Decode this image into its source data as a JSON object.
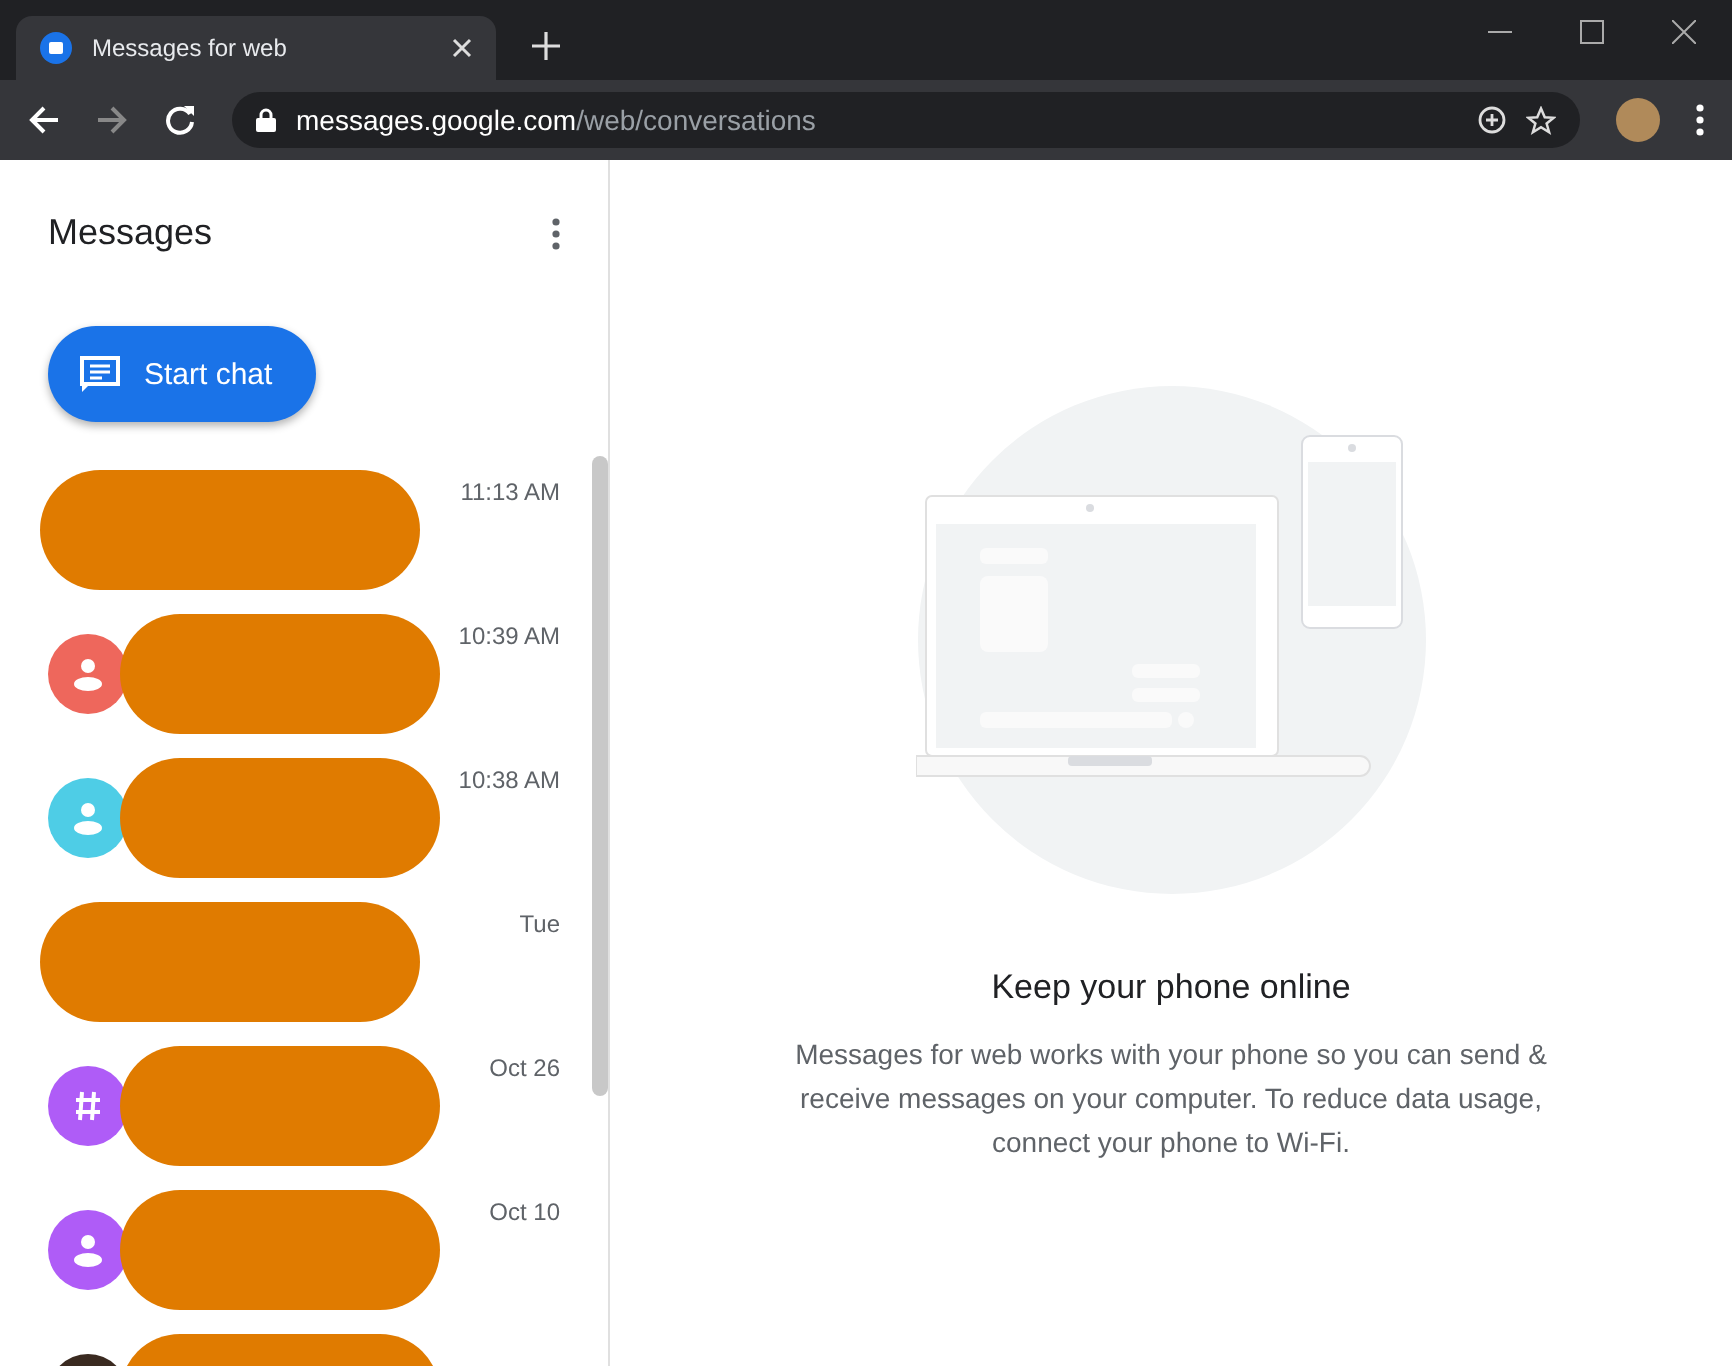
{
  "browser": {
    "tab_title": "Messages for web",
    "url_host": "messages.google.com",
    "url_path": "/web/conversations"
  },
  "sidebar": {
    "title": "Messages",
    "start_chat": "Start chat",
    "conversations": [
      {
        "kind": "plain",
        "time": "11:13 AM"
      },
      {
        "kind": "person",
        "color": "#ee675c",
        "time": "10:39 AM"
      },
      {
        "kind": "person",
        "color": "#4ecde6",
        "time": "10:38 AM"
      },
      {
        "kind": "plain",
        "time": "Tue"
      },
      {
        "kind": "group",
        "color": "#af5cf7",
        "time": "Oct 26"
      },
      {
        "kind": "person",
        "color": "#af5cf7",
        "time": "Oct 10"
      },
      {
        "kind": "photo"
      }
    ]
  },
  "main": {
    "heading": "Keep your phone online",
    "body": "Messages for web works with your phone so you can send & receive messages on your computer. To reduce data usage, connect your phone to Wi-Fi."
  }
}
